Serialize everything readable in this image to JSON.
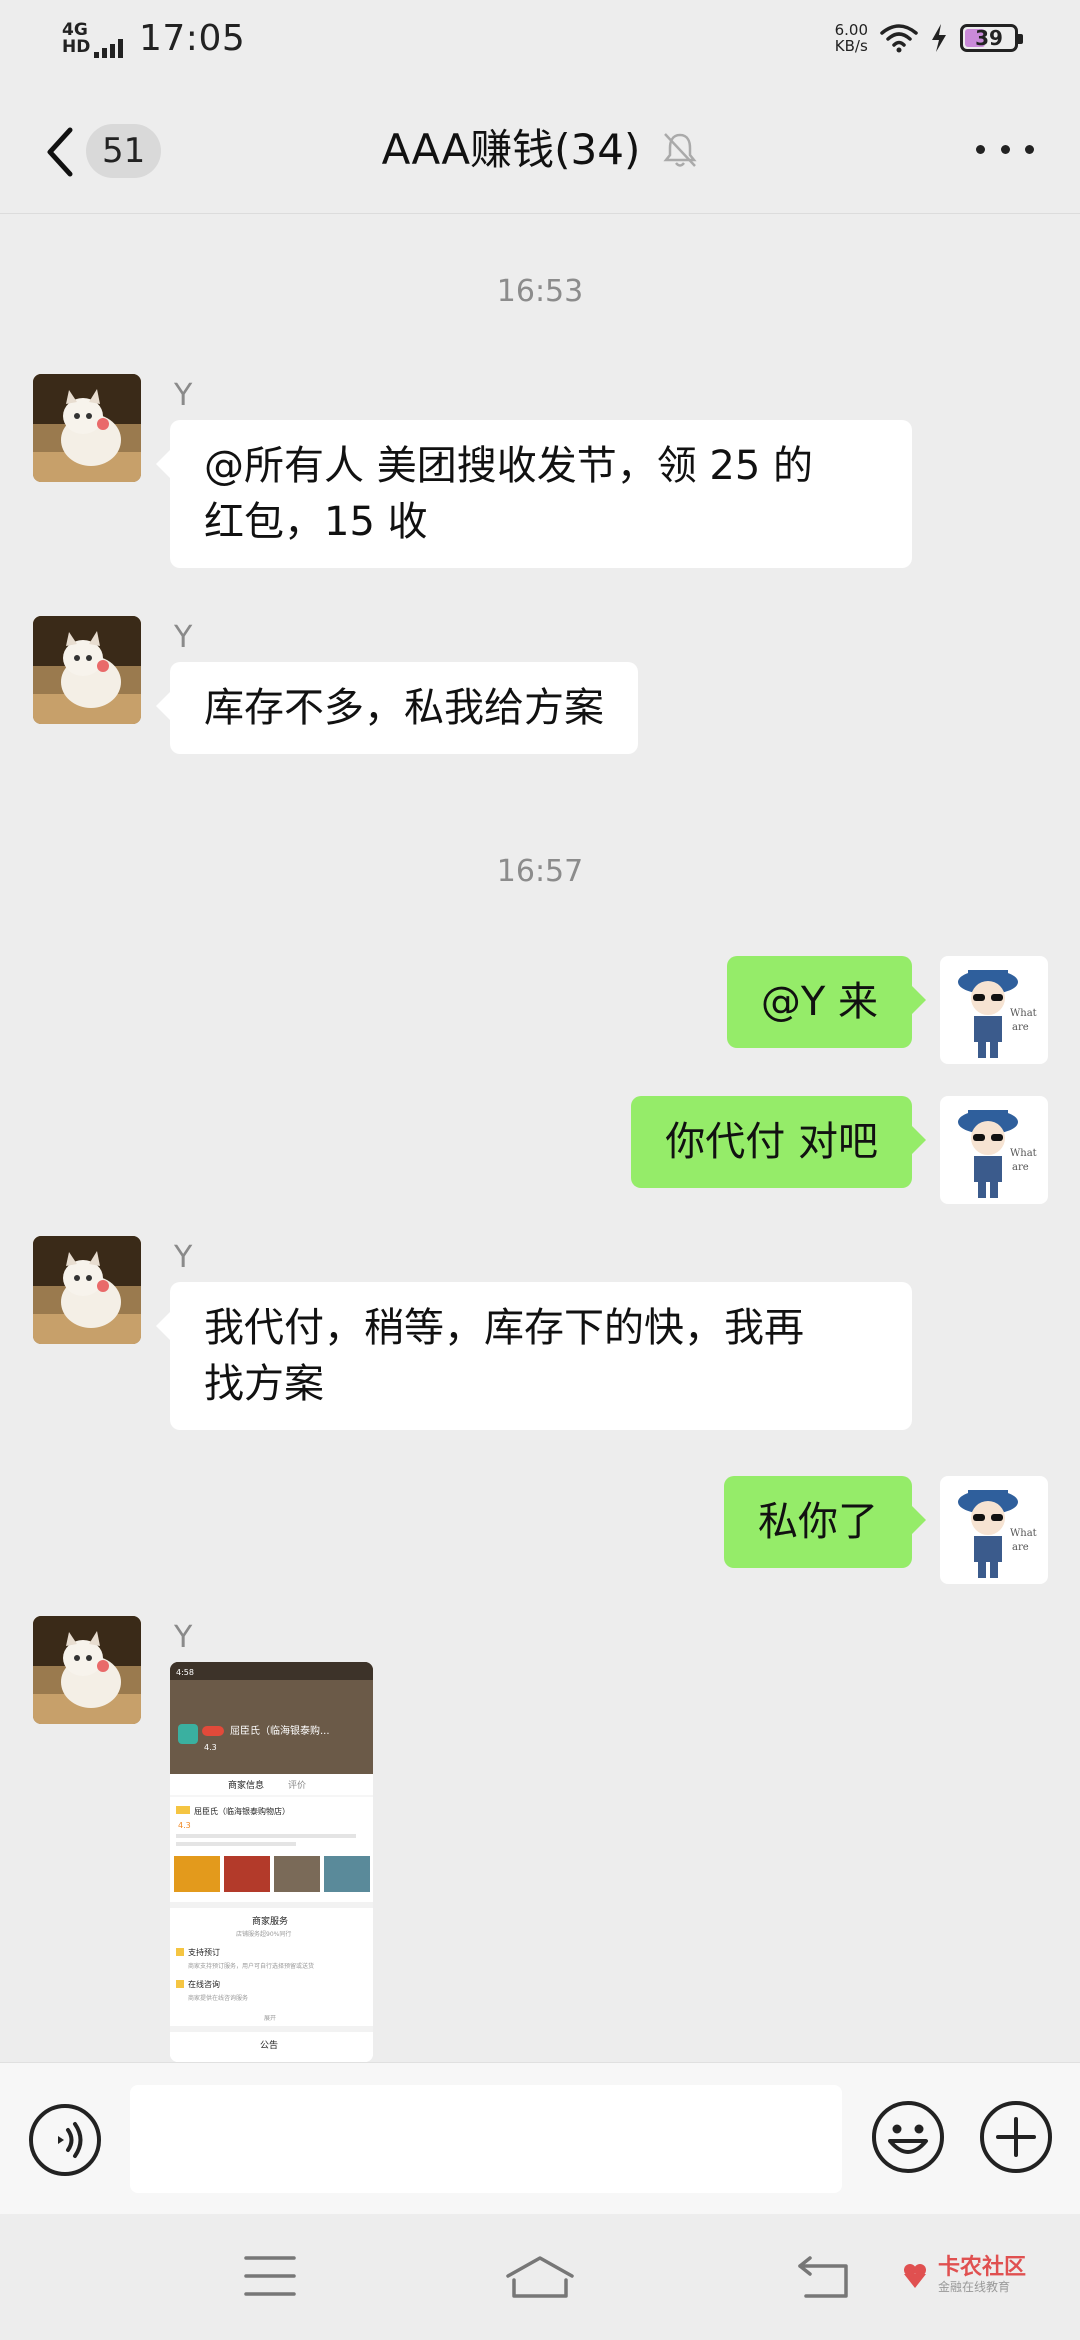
{
  "status_bar": {
    "network": "4G HD",
    "time": "17:05",
    "net_speed_value": "6.00",
    "net_speed_unit": "KB/s",
    "battery": "39",
    "battery_level": 0.39
  },
  "header": {
    "unread_count": "51",
    "title": "AAA赚钱(34)"
  },
  "messages": [
    {
      "type": "time",
      "text": "16:53"
    },
    {
      "type": "incoming",
      "sender": "Y",
      "text_line1": "@所有人  美团搜收发节，领 25 的",
      "text_line2": "红包，15 收"
    },
    {
      "type": "incoming",
      "sender": "Y",
      "text": "库存不多，私我给方案"
    },
    {
      "type": "time",
      "text": "16:57"
    },
    {
      "type": "outgoing",
      "text": "@Y  来"
    },
    {
      "type": "outgoing",
      "text": "你代付 对吧"
    },
    {
      "type": "incoming",
      "sender": "Y",
      "text_line1": "我代付，稍等，库存下的快，我再",
      "text_line2": "找方案"
    },
    {
      "type": "outgoing",
      "text": "私你了"
    },
    {
      "type": "incoming-image",
      "sender": "Y"
    }
  ],
  "shared_image": {
    "status_time": "4:58",
    "rating_badge": "4.3",
    "shop_title": "屈臣氏（临海银泰购...",
    "tab_merchant": "商家信息",
    "tab_review": "评价",
    "shop_name": "屈臣氏（临海银泰购物店）",
    "rating": "4.3",
    "section_service": "商家服务",
    "service_sub": "店铺服务超90%同行",
    "service_1": "支持预订",
    "service_1_desc": "商家支持预订服务，用户可自行选择预留或送货",
    "service_2": "在线咨询",
    "service_2_desc": "商家提供在线咨询服务",
    "expand": "展开",
    "notice": "公告"
  },
  "watermark": {
    "title": "卡农社区",
    "subtitle": "金融在线教育"
  },
  "colors": {
    "background": "#ededed",
    "outgoing_bubble": "#95ec69",
    "incoming_bubble": "#ffffff",
    "time_label": "#8c8c8c"
  }
}
